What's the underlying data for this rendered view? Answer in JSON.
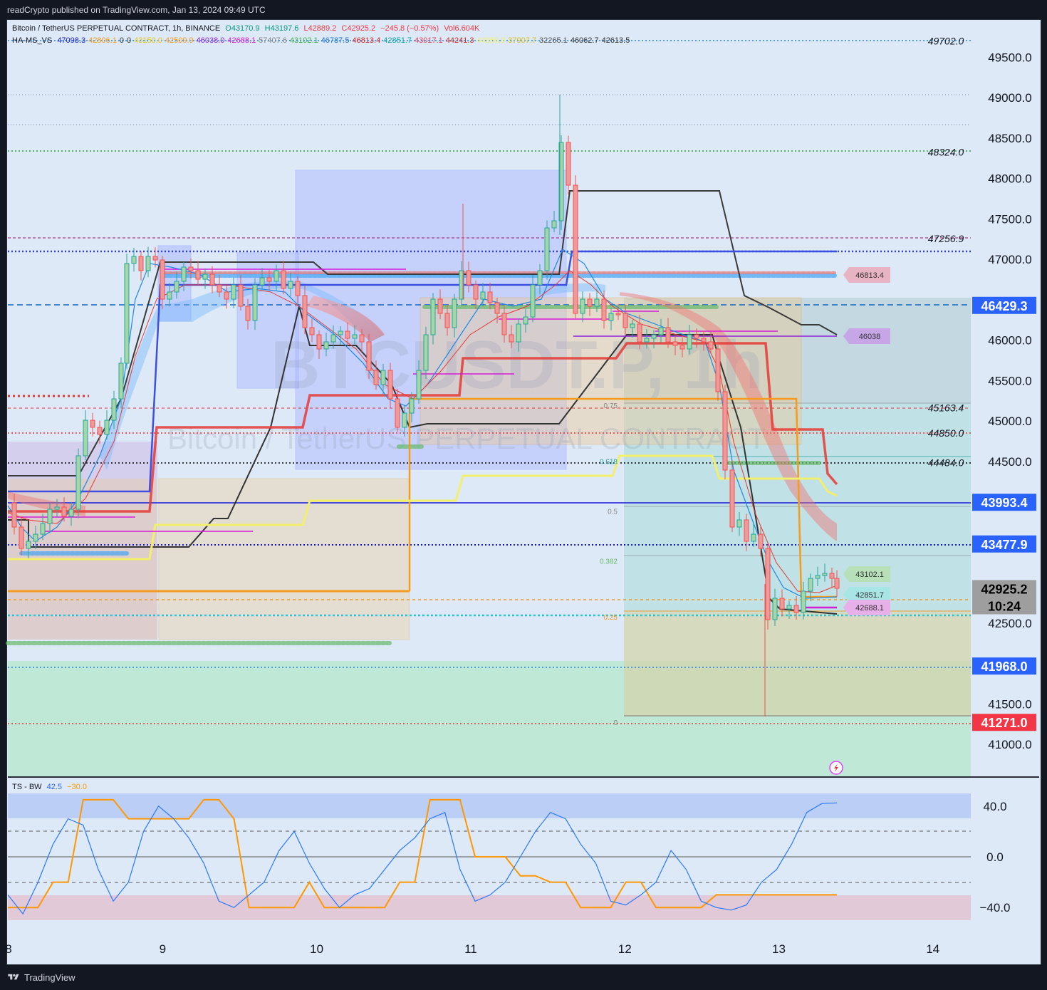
{
  "header": {
    "publish_line": "readCrypto published on TradingView.com, Jan 13, 2024 09:49 UTC"
  },
  "footer": {
    "brand": "TradingView"
  },
  "legend": {
    "symbol": "Bitcoin / TetherUS PERPETUAL CONTRACT, 1h, BINANCE",
    "ohlc": {
      "o": "O43170.9",
      "h": "H43197.6",
      "l": "L42889.2",
      "c": "C42925.2",
      "chg": "−245.8 (−0.57%)",
      "vol": "Vol6.604K"
    },
    "indicator_name": "HA-MS_VS",
    "indicator_values": [
      {
        "v": "47098.3",
        "color": "#1e22c9"
      },
      {
        "v": "42806.1",
        "color": "#f59b1d"
      },
      {
        "v": "0",
        "color": "#333333"
      },
      {
        "v": "0",
        "color": "#333333"
      },
      {
        "v": "43150.0",
        "color": "#e5c51a"
      },
      {
        "v": "42509.9",
        "color": "#f59b1d"
      },
      {
        "v": "46038.0",
        "color": "#8e24d8"
      },
      {
        "v": "42688.1",
        "color": "#d81bd8"
      },
      {
        "v": "57407.6",
        "color": "#888888"
      },
      {
        "v": "43102.1",
        "color": "#3fae49"
      },
      {
        "v": "46787.5",
        "color": "#2a74d9"
      },
      {
        "v": "46813.4",
        "color": "#d12b2b"
      },
      {
        "v": "42851.7",
        "color": "#14a3a3"
      },
      {
        "v": "43017.1",
        "color": "#e0425c"
      },
      {
        "v": "44241.3",
        "color": "#d12b2b"
      },
      {
        "v": "44959.9",
        "color": "#f2ef6a"
      },
      {
        "v": "37907.7",
        "color": "#d8c020"
      },
      {
        "v": "32265.1",
        "color": "#555555"
      },
      {
        "v": "46062.7",
        "color": "#333333"
      },
      {
        "v": "42613.5",
        "color": "#333333"
      }
    ],
    "osc_name": "TS - BW",
    "osc_v1": "42.5",
    "osc_v2": "−30.0"
  },
  "watermark": {
    "big": "BTCUSDT.P, 1h",
    "small": "Bitcoin / TetherUS PERPETUAL CONTRACT"
  },
  "price_axis": {
    "ticks": [
      "49500.0",
      "49000.0",
      "48500.0",
      "48000.0",
      "47500.0",
      "47000.0",
      "46000.0",
      "45500.0",
      "45000.0",
      "44500.0",
      "42500.0",
      "41500.0",
      "41000.0"
    ]
  },
  "osc_axis": {
    "ticks": [
      "40.0",
      "0.0",
      "−40.0"
    ]
  },
  "time_axis": {
    "labels": [
      "8",
      "9",
      "10",
      "11",
      "12",
      "13",
      "14"
    ]
  },
  "level_labels": [
    "49702.0",
    "48324.0",
    "47256.9",
    "45163.4",
    "44850.0",
    "44484.0"
  ],
  "fib_labels": [
    "0.75",
    "0.618",
    "0.5",
    "0.382",
    "0.25",
    "0"
  ],
  "price_badges": [
    {
      "text": "46429.3",
      "bg": "#2962ff",
      "fg": "#ffffff"
    },
    {
      "text": "43993.4",
      "bg": "#2962ff",
      "fg": "#ffffff"
    },
    {
      "text": "43477.9",
      "bg": "#2962ff",
      "fg": "#ffffff"
    },
    {
      "text": "42925.2",
      "bg": "#9e9e9e",
      "fg": "#000000"
    },
    {
      "text": "10:24",
      "bg": "#9e9e9e",
      "fg": "#000000"
    },
    {
      "text": "41968.0",
      "bg": "#2962ff",
      "fg": "#ffffff"
    },
    {
      "text": "41271.0",
      "bg": "#f23645",
      "fg": "#ffffff"
    }
  ],
  "tags": [
    {
      "text": "46813.4",
      "bg": "#e8b3c3"
    },
    {
      "text": "46038",
      "bg": "#c7a6e8"
    },
    {
      "text": "43102.1",
      "bg": "#b7e0b9"
    },
    {
      "text": "42851.7",
      "bg": "#a8e6e6"
    },
    {
      "text": "42688.1",
      "bg": "#e8b0e8"
    }
  ],
  "chart_data": [
    {
      "type": "candlestick",
      "title": "Bitcoin / TetherUS PERPETUAL CONTRACT, 1h, BINANCE",
      "x": [
        "Jan 8",
        "Jan 9",
        "Jan 10",
        "Jan 11",
        "Jan 12",
        "Jan 13",
        "Jan 14"
      ],
      "ylim": [
        40600,
        50000
      ],
      "y_scale": "linear",
      "last_price": 42925.2,
      "series": [
        {
          "name": "close (approx.)",
          "values": [
            43300,
            47000,
            46000,
            46800,
            46000,
            42600,
            42925
          ]
        }
      ],
      "horizontal_levels": [
        49702.0,
        48324.0,
        47256.9,
        47098.3,
        46429.3,
        45163.4,
        44850.0,
        44484.0,
        43993.4,
        43477.9,
        41968.0,
        41271.0
      ],
      "fib_retracement": {
        "levels": [
          0.75,
          0.618,
          0.5,
          0.382,
          0.25,
          0
        ],
        "top": 46500,
        "bottom": 41271
      }
    },
    {
      "type": "line",
      "title": "TS - BW",
      "ylim": [
        -55,
        55
      ],
      "bands": {
        "upper": 40,
        "lower": -40
      },
      "series": [
        {
          "name": "42.5",
          "color": "#e040fb",
          "values": [
            -30,
            -45,
            -20,
            10,
            30,
            25,
            -10,
            -35,
            -20,
            20,
            40,
            30,
            15,
            -5,
            -35,
            -40,
            -30,
            -20,
            5,
            20,
            -5,
            -25,
            -40,
            -30,
            -25,
            -10,
            5,
            15,
            30,
            35,
            -10,
            -35,
            -30,
            -20,
            0,
            20,
            35,
            30,
            10,
            -5,
            -35,
            -38,
            -30,
            -20,
            5,
            -10,
            -35,
            -40,
            -42,
            -38,
            -20,
            -10,
            10,
            35,
            42,
            42.5
          ]
        },
        {
          "name": "−30.0",
          "color": "#ff9800",
          "values": [
            -40,
            -40,
            -40,
            -20,
            -20,
            45,
            45,
            45,
            30,
            30,
            30,
            30,
            30,
            45,
            45,
            30,
            -40,
            -40,
            -40,
            -40,
            -20,
            -40,
            -40,
            -40,
            -40,
            -40,
            -20,
            -20,
            45,
            45,
            45,
            0,
            0,
            0,
            -15,
            -15,
            -20,
            -20,
            -40,
            -40,
            -40,
            -20,
            -20,
            -40,
            -40,
            -40,
            -40,
            -30,
            -30,
            -30,
            -30,
            -30,
            -30,
            -30,
            -30,
            -30
          ]
        }
      ]
    }
  ]
}
